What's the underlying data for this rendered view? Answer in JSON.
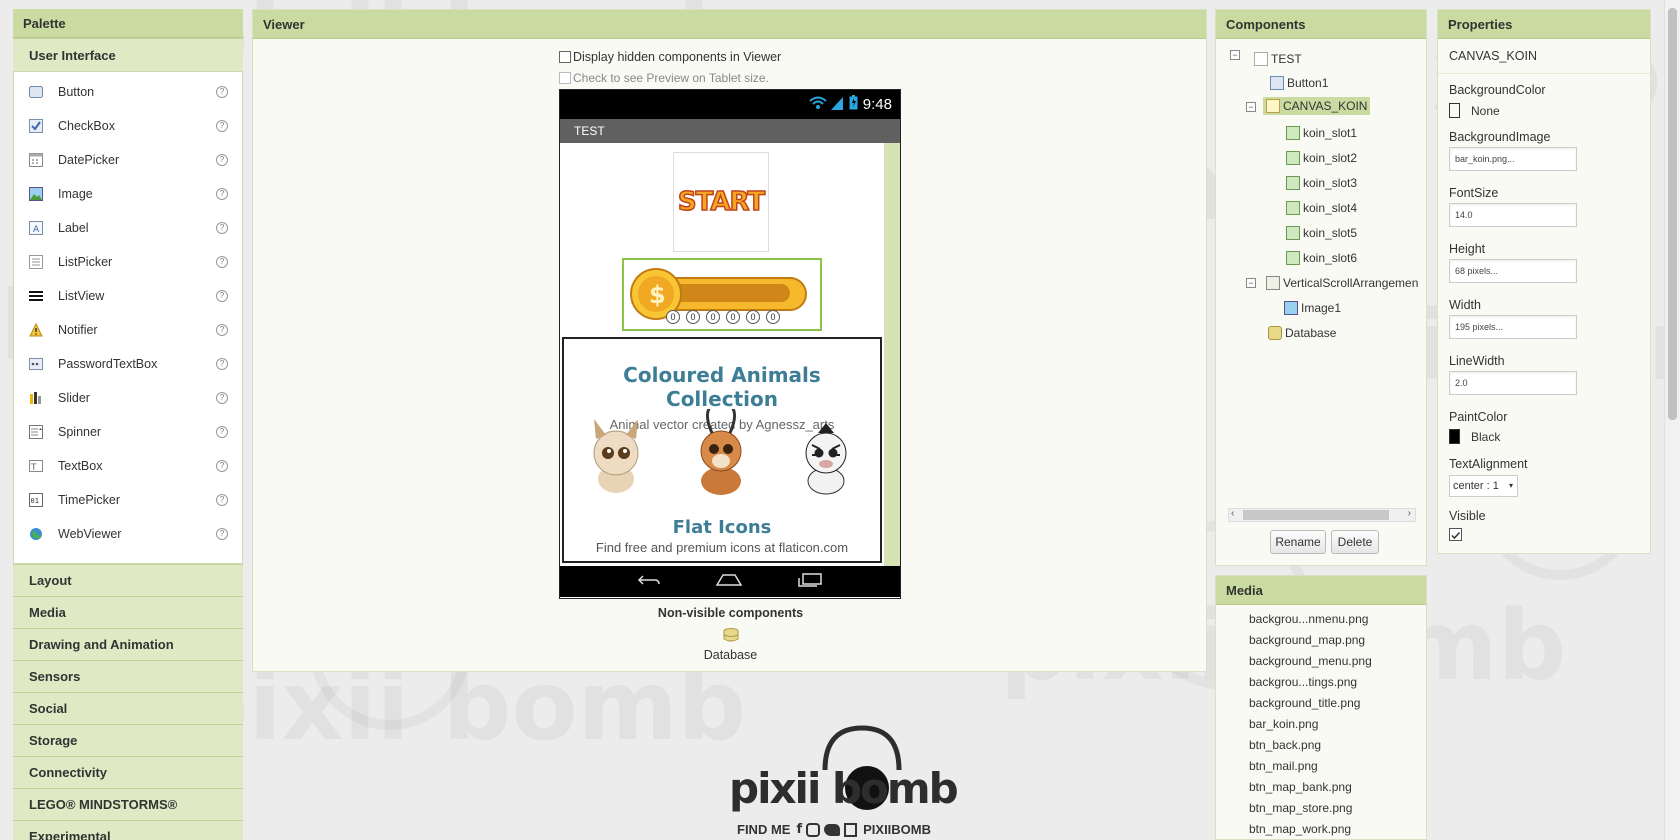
{
  "watermark": "pixii bomb",
  "palette": {
    "title": "Palette",
    "open_category": "User Interface",
    "items": [
      {
        "label": "Button",
        "icon": "button-icon"
      },
      {
        "label": "CheckBox",
        "icon": "checkbox-icon"
      },
      {
        "label": "DatePicker",
        "icon": "datepicker-icon"
      },
      {
        "label": "Image",
        "icon": "image-icon"
      },
      {
        "label": "Label",
        "icon": "label-icon"
      },
      {
        "label": "ListPicker",
        "icon": "listpicker-icon"
      },
      {
        "label": "ListView",
        "icon": "listview-icon"
      },
      {
        "label": "Notifier",
        "icon": "notifier-icon"
      },
      {
        "label": "PasswordTextBox",
        "icon": "passwordtextbox-icon"
      },
      {
        "label": "Slider",
        "icon": "slider-icon"
      },
      {
        "label": "Spinner",
        "icon": "spinner-icon"
      },
      {
        "label": "TextBox",
        "icon": "textbox-icon"
      },
      {
        "label": "TimePicker",
        "icon": "timepicker-icon"
      },
      {
        "label": "WebViewer",
        "icon": "webviewer-icon"
      }
    ],
    "help_glyph": "?",
    "categories": [
      "Layout",
      "Media",
      "Drawing and Animation",
      "Sensors",
      "Social",
      "Storage",
      "Connectivity",
      "LEGO® MINDSTORMS®",
      "Experimental"
    ]
  },
  "viewer": {
    "title": "Viewer",
    "display_hidden_label": "Display hidden components in Viewer",
    "tablet_preview_label": "Check to see Preview on Tablet size.",
    "phone": {
      "time": "9:48",
      "screen_title": "TEST",
      "start_button_text": "START",
      "koin_digits": [
        "0",
        "0",
        "0",
        "0",
        "0",
        "0"
      ],
      "image_title": "Coloured Animals Collection",
      "image_credit": "Animal vector created by Agnessz_arts",
      "image_footer_title": "Flat Icons",
      "image_footer_sub": "Find free and premium icons at flaticon.com"
    },
    "nonvisible_label": "Non-visible components",
    "nonvisible_items": [
      "Database"
    ]
  },
  "components": {
    "title": "Components",
    "tree": [
      {
        "label": "TEST",
        "depth": 0,
        "toggle": "⊟",
        "icon": "screen-icon"
      },
      {
        "label": "Button1",
        "depth": 1,
        "icon": "button-icon"
      },
      {
        "label": "CANVAS_KOIN",
        "depth": 1,
        "toggle": "⊟",
        "icon": "canvas-icon",
        "selected": true
      },
      {
        "label": "koin_slot1",
        "depth": 2,
        "icon": "imagesprite-icon"
      },
      {
        "label": "koin_slot2",
        "depth": 2,
        "icon": "imagesprite-icon"
      },
      {
        "label": "koin_slot3",
        "depth": 2,
        "icon": "imagesprite-icon"
      },
      {
        "label": "koin_slot4",
        "depth": 2,
        "icon": "imagesprite-icon"
      },
      {
        "label": "koin_slot5",
        "depth": 2,
        "icon": "imagesprite-icon"
      },
      {
        "label": "koin_slot6",
        "depth": 2,
        "icon": "imagesprite-icon"
      },
      {
        "label": "VerticalScrollArrangemen",
        "depth": 1,
        "toggle": "⊟",
        "icon": "arrangement-icon"
      },
      {
        "label": "Image1",
        "depth": 2,
        "icon": "image-icon"
      },
      {
        "label": "Database",
        "depth": 1,
        "icon": "database-icon"
      }
    ],
    "rename_label": "Rename",
    "delete_label": "Delete"
  },
  "media": {
    "title": "Media",
    "items": [
      "backgrou...nmenu.png",
      "background_map.png",
      "background_menu.png",
      "backgrou...tings.png",
      "background_title.png",
      "bar_koin.png",
      "btn_back.png",
      "btn_mail.png",
      "btn_map_bank.png",
      "btn_map_store.png",
      "btn_map_work.png"
    ]
  },
  "properties": {
    "title": "Properties",
    "component": "CANVAS_KOIN",
    "background_color_label": "BackgroundColor",
    "background_color_value": "None",
    "background_color_hex": "#ffffff",
    "background_image_label": "BackgroundImage",
    "background_image_value": "bar_koin.png...",
    "font_size_label": "FontSize",
    "font_size_value": "14.0",
    "height_label": "Height",
    "height_value": "68 pixels...",
    "width_label": "Width",
    "width_value": "195 pixels...",
    "line_width_label": "LineWidth",
    "line_width_value": "2.0",
    "paint_color_label": "PaintColor",
    "paint_color_value": "Black",
    "paint_color_hex": "#000000",
    "text_alignment_label": "TextAlignment",
    "text_alignment_value": "center : 1",
    "visible_label": "Visible",
    "visible_checked": true
  },
  "logo": {
    "text": "pixii bomb",
    "find_me": "FIND ME",
    "handle": "PIXIIBOMB"
  },
  "colors": {
    "header_green": "#c9dba0",
    "selected_green": "#c9dba0",
    "title_teal": "#3d7e96"
  }
}
